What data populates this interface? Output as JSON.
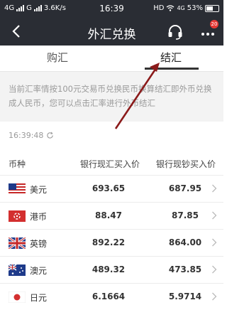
{
  "status_bar": {
    "carrier_left": "4G",
    "carrier_mid": "G",
    "speed": "3.6K/s",
    "time": "16:39",
    "hd": "HD",
    "net": "4G",
    "battery": "53%"
  },
  "header": {
    "title": "外汇兑换",
    "notification_count": "20"
  },
  "tabs": [
    {
      "label": "购汇"
    },
    {
      "label": "结汇"
    }
  ],
  "notice": "当前汇率情按100元交易币兑换民币换算结汇即外币兑换成人民币，您可以点击汇率进行外币结汇",
  "update_time": "16:39:48",
  "table": {
    "headers": [
      "币种",
      "银行现汇买入价",
      "银行现钞买入价"
    ],
    "rows": [
      {
        "flag": "us-flag",
        "currency": "美元",
        "spot_buy": "693.65",
        "cash_buy": "687.95"
      },
      {
        "flag": "hk-flag",
        "currency": "港币",
        "spot_buy": "88.47",
        "cash_buy": "87.85"
      },
      {
        "flag": "uk-flag",
        "currency": "英镑",
        "spot_buy": "892.22",
        "cash_buy": "864.00"
      },
      {
        "flag": "au-flag",
        "currency": "澳元",
        "spot_buy": "489.32",
        "cash_buy": "473.85"
      },
      {
        "flag": "jp-flag",
        "currency": "日元",
        "spot_buy": "6.1664",
        "cash_buy": "5.9714"
      }
    ]
  },
  "colors": {
    "header_bg": "#2a2d34",
    "badge": "#e53935",
    "annotation_arrow": "#8b1a1a"
  }
}
